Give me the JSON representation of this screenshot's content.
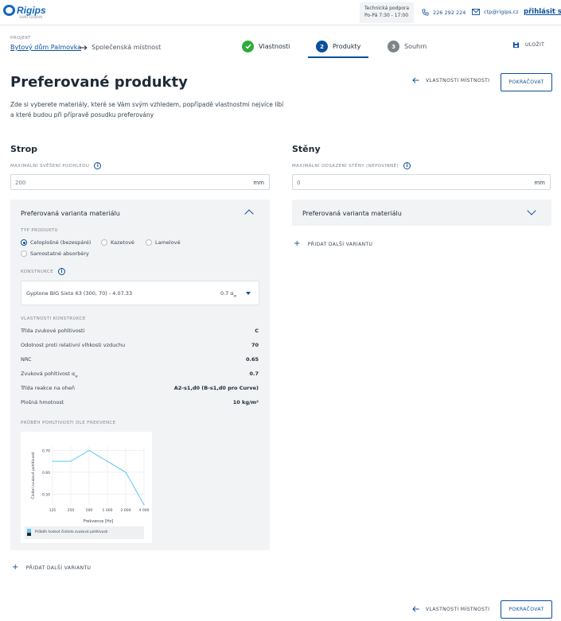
{
  "header": {
    "logo_text": "Rigips",
    "logo_sub": "SAINT-GOBAIN",
    "support_title": "Technická podpora",
    "support_hours": "Po-Pá 7:30 - 17:00",
    "phone": "226 292 224",
    "email": "ctp@rigips.cz",
    "login": "přihlásit se"
  },
  "breadcrumb": {
    "label": "PROJEKT",
    "project": "Bytový dům Palmovka",
    "room": "Společenská místnost"
  },
  "steps": [
    {
      "num": "1",
      "label": "Vlastnosti",
      "state": "done"
    },
    {
      "num": "2",
      "label": "Produkty",
      "state": "active"
    },
    {
      "num": "3",
      "label": "Souhrn",
      "state": "todo"
    }
  ],
  "save_label": "ULOŽIT",
  "page": {
    "title": "Preferované produkty",
    "intro": "Zde si vyberete materiály, které se Vám svým vzhledem, popřípadě vlastnostmi nejvíce líbí a které budou při přípravě posudku preferovány",
    "back_label": "VLASTNOSTI MÍSTNOSTI",
    "continue_label": "POKRAČOVAT"
  },
  "strop": {
    "title": "Strop",
    "field_label": "MAXIMÁLNÍ SVĚŠENÍ PODHLEDU",
    "field_value": "200",
    "field_unit": "mm",
    "panel_title": "Preferovaná varianta materiálu",
    "type_label": "TYP PRODUKTU",
    "types": [
      "Celoplošné (bezespáré)",
      "Kazetové",
      "Lamelové",
      "Samostatné absorbéry"
    ],
    "selected_type": 0,
    "construction_label": "KONSTRUKCE",
    "construction_value": "Gyptone BIG Sixto 63 (300, 70) - 4.07.33",
    "construction_alpha_value": "0.7",
    "construction_alpha_symbol": "α",
    "construction_alpha_sub": "w",
    "props_label": "VLASTNOSTI KONSTRUKCE",
    "props": [
      {
        "label": "Třída zvukové pohltivosti",
        "value": "C"
      },
      {
        "label": "Odolnost proti relativní vlhkosti vzduchu",
        "value": "70"
      },
      {
        "label": "NRC",
        "value": "0.65"
      },
      {
        "label": "Zvuková pohltivost",
        "label_symbol": "α",
        "label_sub": "w",
        "value": "0.7"
      },
      {
        "label": "Třída reakce na oheň",
        "value": "A2-s1,d0 (B-s1,d0 pro Curve)"
      },
      {
        "label": "Plošná hmotnost",
        "value": "10 kg/m²"
      }
    ],
    "chart_label": "PRŮBĚH POHLTIVOSTI DLE FREKVENCE",
    "add_label": "PŘIDAT DALŠÍ VARIANTU"
  },
  "steny": {
    "title": "Stěny",
    "field_label": "MAXIMÁLNÍ ODSAZENÍ STĚNY (NEPOVINNÉ)",
    "field_value": "0",
    "field_unit": "mm",
    "panel_title": "Preferovaná varianta materiálu",
    "add_label": "PŘIDAT DALŠÍ VARIANTU"
  },
  "chart_data": {
    "type": "line",
    "categories": [
      "125",
      "250",
      "500",
      "1 000",
      "2 000",
      "4 000"
    ],
    "series": [
      {
        "name": "Průběh hodnot činitele zvukové pohltivosti",
        "values": [
          0.65,
          0.65,
          0.7,
          0.65,
          0.6,
          0.45
        ]
      }
    ],
    "xlabel": "Frekvence [Hz]",
    "ylabel": "Činitel zvukové pohltivosti",
    "y_ticks": [
      "0.70",
      "0.60",
      "0.50"
    ],
    "ylim": [
      0.45,
      0.72
    ],
    "grid": true,
    "legend": "bottom",
    "color": "#5bc8f5"
  },
  "colors": {
    "primary": "#0b4f9c",
    "success": "#2eab3b",
    "inactive": "#7d8389",
    "chart_line": "#5bc8f5"
  },
  "icons": [
    "phone-icon",
    "mail-icon",
    "check-icon",
    "save-icon",
    "arrow-left-icon",
    "info-icon",
    "chevron-up-icon",
    "chevron-down-icon",
    "dropdown-caret-icon",
    "plus-icon"
  ]
}
